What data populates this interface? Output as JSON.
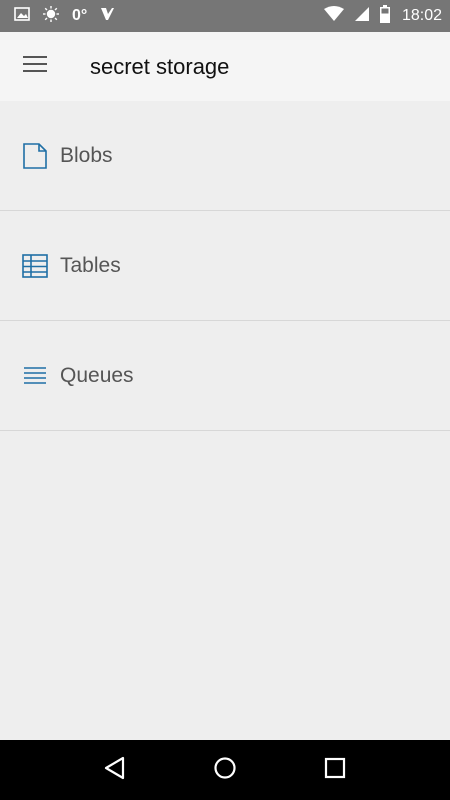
{
  "status_bar": {
    "temperature": "0°",
    "time": "18:02",
    "icons": [
      "image-icon",
      "brightness-icon",
      "app-notification-icon",
      "wifi-icon",
      "signal-icon",
      "battery-icon"
    ]
  },
  "app_bar": {
    "title": "secret storage",
    "menu_icon": "hamburger-menu-icon"
  },
  "list": {
    "items": [
      {
        "label": "Blobs",
        "icon": "file-icon"
      },
      {
        "label": "Tables",
        "icon": "table-icon"
      },
      {
        "label": "Queues",
        "icon": "queue-list-icon"
      }
    ]
  },
  "nav_bar": {
    "icons": [
      "back-icon",
      "home-icon",
      "recents-icon"
    ]
  },
  "colors": {
    "status_bar": "#767676",
    "app_bar": "#f5f5f5",
    "background": "#eeeeee",
    "accent_icon": "#1f6fa5",
    "nav_bar": "#000000"
  }
}
